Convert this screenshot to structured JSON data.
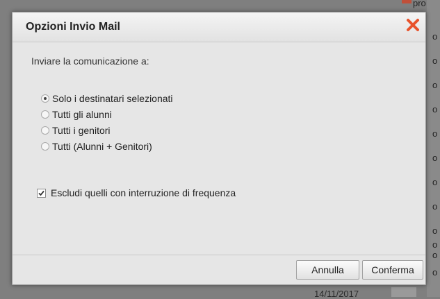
{
  "background": {
    "peek_top": "pro",
    "peek_letters": [
      "o",
      "o",
      "o",
      "o",
      "o",
      "o",
      "o",
      "o",
      "o",
      "o",
      "o",
      "o"
    ],
    "bottom_date": "14/11/2017"
  },
  "dialog": {
    "title": "Opzioni Invio Mail",
    "close_icon": "close-icon",
    "prompt": "Inviare la comunicazione a:",
    "options": [
      {
        "label": "Solo i destinatari selezionati",
        "checked": true
      },
      {
        "label": "Tutti gli alunni",
        "checked": false
      },
      {
        "label": "Tutti i genitori",
        "checked": false
      },
      {
        "label": "Tutti (Alunni + Genitori)",
        "checked": false
      }
    ],
    "exclude": {
      "label": "Escludi quelli con interruzione di frequenza",
      "checked": true
    },
    "buttons": {
      "cancel": "Annulla",
      "confirm": "Conferma"
    },
    "colors": {
      "close": "#e8532c"
    }
  }
}
